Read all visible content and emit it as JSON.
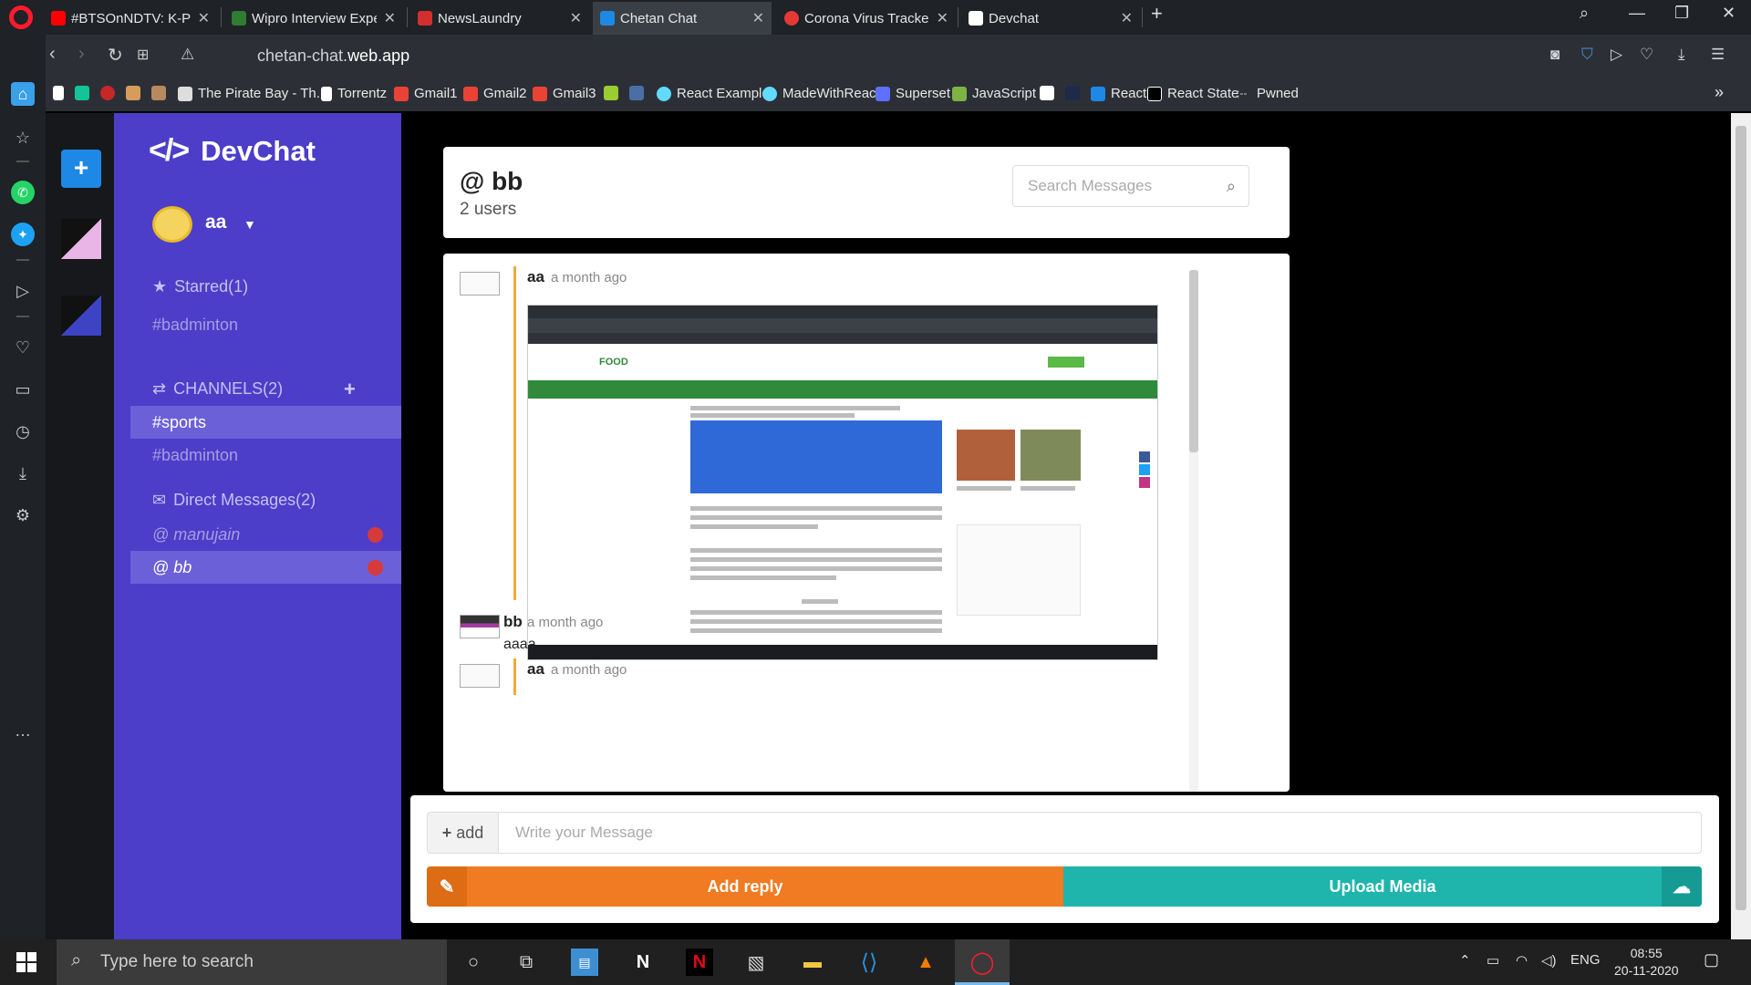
{
  "browser": {
    "tabs": [
      {
        "title": "#BTSOnNDTV: K-Pop Sensa",
        "color": "#ff0000"
      },
      {
        "title": "Wipro Interview Experience",
        "color": "#2e7d32"
      },
      {
        "title": "NewsLaundry",
        "color": "#d32f2f"
      },
      {
        "title": "Chetan Chat",
        "color": "#1e88e5"
      },
      {
        "title": "Corona Virus Tracker",
        "color": "#e53935"
      },
      {
        "title": "Devchat",
        "color": "#ffffff"
      }
    ],
    "url_prefix": "chetan-chat.",
    "url_domain": "web.app",
    "bookmarks": [
      {
        "label": "The Pirate Bay - Th...",
        "color": "#ffffff"
      },
      {
        "label": "Torrentz",
        "color": "#ffffff"
      },
      {
        "label": "Gmail1",
        "color": "#ea4335"
      },
      {
        "label": "Gmail2",
        "color": "#ea4335"
      },
      {
        "label": "Gmail3",
        "color": "#ea4335"
      },
      {
        "label": "React Examples",
        "color": "#61dafb"
      },
      {
        "label": "MadeWithReact",
        "color": "#61dafb"
      },
      {
        "label": "Superset",
        "color": "#5f6fff"
      },
      {
        "label": "JavaScript",
        "color": "#7cb342"
      },
      {
        "label": "React",
        "color": "#1e88e5"
      },
      {
        "label": "React State",
        "color": "#ffffff"
      },
      {
        "label": "Pwned",
        "color": "#cccccc"
      }
    ]
  },
  "app": {
    "name": "DevChat",
    "logo_glyph": "</>",
    "user": "aa",
    "starred": {
      "title": "Starred(1)",
      "items": [
        "#badminton"
      ]
    },
    "channels": {
      "title": "CHANNELS(2)",
      "items": [
        "#sports",
        "#badminton"
      ],
      "active": "#sports"
    },
    "direct": {
      "title": "Direct Messages(2)",
      "items": [
        "@ manujain",
        "@ bb"
      ],
      "active": "@ bb"
    }
  },
  "header": {
    "title": "@ bb",
    "subtitle": "2 users",
    "search_placeholder": "Search Messages"
  },
  "messages": [
    {
      "author": "aa",
      "time": "a month ago",
      "text": "",
      "has_image": true,
      "own": true
    },
    {
      "author": "bb",
      "time": "a month ago",
      "text": "aaaa",
      "has_image": false,
      "own": false
    },
    {
      "author": "aa",
      "time": "a month ago",
      "text": "",
      "has_image": false,
      "own": true
    }
  ],
  "composer": {
    "add_label": "add",
    "placeholder": "Write your Message",
    "reply_label": "Add reply",
    "upload_label": "Upload Media"
  },
  "taskbar": {
    "search_placeholder": "Type here to search",
    "language": "ENG",
    "time": "08:55",
    "date": "20-11-2020"
  },
  "colors": {
    "sidepanel": "#4c3ec9",
    "reply": "#f07b22",
    "upload": "#1fb5ad"
  }
}
